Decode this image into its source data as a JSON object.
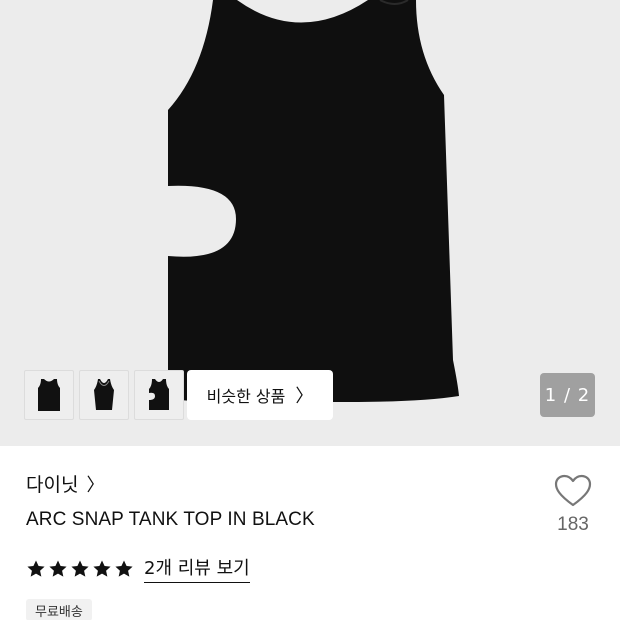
{
  "gallery": {
    "thumbnail_icons": [
      "tank-top-front-icon",
      "tank-top-detail-icon",
      "tank-top-side-icon"
    ],
    "similar_label": "비슷한 상품",
    "pager": "1 / 2"
  },
  "product": {
    "brand": "다이닛",
    "title": "ARC SNAP TANK TOP IN BLACK",
    "rating": 5,
    "review_link": "2개 리뷰 보기",
    "badge": "무료배송",
    "likes": "183"
  },
  "colors": {
    "hero_bg": "#ececec",
    "garment": "#0f0f0f",
    "text": "#111111",
    "muted": "#666666"
  }
}
